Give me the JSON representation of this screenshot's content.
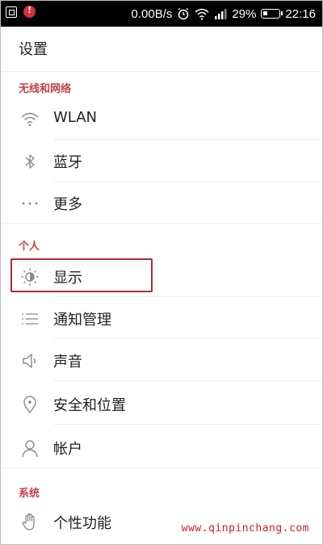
{
  "status_bar": {
    "net_speed": "0.00B/s",
    "battery_pct": "29%",
    "time": "22:16"
  },
  "title": "设置",
  "sections": {
    "wireless": "无线和网络",
    "personal": "个人",
    "system": "系统"
  },
  "items": {
    "wlan": "WLAN",
    "bluetooth": "蓝牙",
    "more": "更多",
    "display": "显示",
    "notifications": "通知管理",
    "sound": "声音",
    "security": "安全和位置",
    "accounts": "帐户",
    "features": "个性功能"
  },
  "icons": {
    "wlan": "wifi-icon",
    "bluetooth": "bluetooth-icon",
    "more": "more-dots-icon",
    "display": "brightness-icon",
    "notifications": "list-icon",
    "sound": "speaker-icon",
    "security": "location-pin-icon",
    "accounts": "person-icon",
    "features": "hand-icon"
  },
  "colors": {
    "section_label": "#c6414a",
    "highlight_border": "#b02a33",
    "status_bar_bg": "#000000",
    "watermark": "#d61d1d"
  },
  "watermark": "www.qinpinchang.com"
}
